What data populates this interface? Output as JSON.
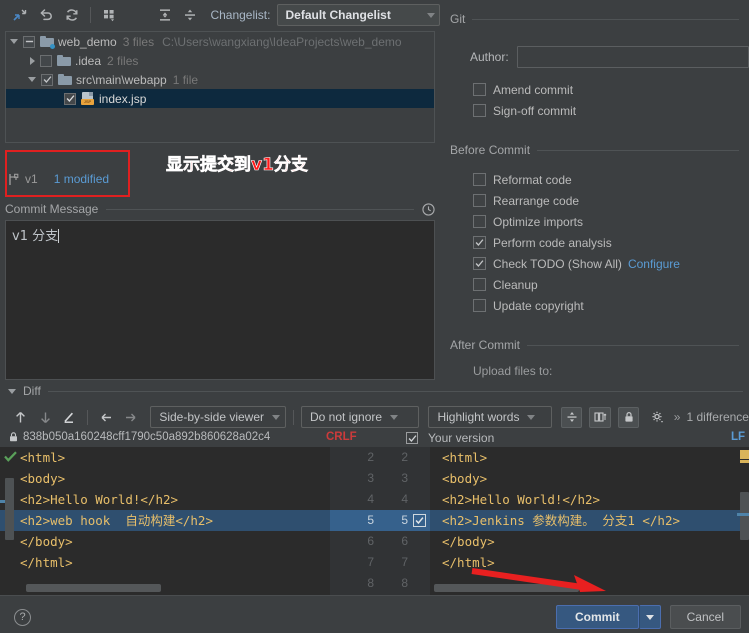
{
  "toolbar": {
    "icons": [
      "collapse-all-icon",
      "undo-icon",
      "refresh-icon",
      "group-by-icon",
      "expand-all-icon",
      "collapse-lines-icon"
    ],
    "changelist_label": "Changelist:",
    "changelist_value": "Default Changelist"
  },
  "tree": {
    "rows": [
      {
        "name": "web_demo",
        "meta": "3 files",
        "path": "C:\\Users\\wangxiang\\IdeaProjects\\web_demo",
        "indent": 0,
        "expanded": true,
        "checkstate": "partial",
        "icon": "folder-icon",
        "selected": false
      },
      {
        "name": ".idea",
        "meta": "2 files",
        "path": "",
        "indent": 1,
        "expanded": false,
        "checkstate": "off",
        "icon": "folder-icon",
        "selected": false
      },
      {
        "name": "src\\main\\webapp",
        "meta": "1 file",
        "path": "",
        "indent": 1,
        "expanded": true,
        "checkstate": "on",
        "icon": "folder-icon",
        "selected": false
      },
      {
        "name": "index.jsp",
        "meta": "",
        "path": "",
        "indent": 2,
        "expanded": null,
        "checkstate": "on",
        "icon": "jsp-file-icon",
        "selected": true
      }
    ]
  },
  "branch": {
    "icon": "git-branch-icon",
    "name": "v1",
    "modified": "1 modified",
    "annotation": "显示提交到v1分支",
    "annotation_color": "#ff1a1a",
    "highlight_color": "#e02020"
  },
  "commit_message": {
    "title": "Commit Message",
    "history_icon": "clock-icon",
    "value": "v1 分支"
  },
  "git_panel": {
    "section_git": "Git",
    "author_label": "Author:",
    "author_value": "",
    "git_checks": [
      {
        "label": "Amend commit",
        "checked": false
      },
      {
        "label": "Sign-off commit",
        "checked": false
      }
    ],
    "section_before": "Before Commit",
    "before_checks": [
      {
        "label": "Reformat code",
        "checked": false,
        "link": ""
      },
      {
        "label": "Rearrange code",
        "checked": false,
        "link": ""
      },
      {
        "label": "Optimize imports",
        "checked": false,
        "link": ""
      },
      {
        "label": "Perform code analysis",
        "checked": true,
        "link": ""
      },
      {
        "label": "Check TODO (Show All)",
        "checked": true,
        "link": "Configure"
      },
      {
        "label": "Cleanup",
        "checked": false,
        "link": ""
      },
      {
        "label": "Update copyright",
        "checked": false,
        "link": ""
      }
    ],
    "section_after": "After Commit",
    "after_label": "Upload files to:"
  },
  "diff": {
    "title": "Diff",
    "nav_icons": [
      "prev-diff-icon",
      "next-diff-icon",
      "edit-icon",
      "apply-left-icon",
      "apply-right-icon"
    ],
    "viewer_mode": "Side-by-side viewer",
    "ignore_mode": "Do not ignore",
    "highlight_mode": "Highlight words",
    "toggle_icons": [
      "collapse-unchanged-icon",
      "toggle-columns-icon",
      "lock-icon",
      "settings-icon"
    ],
    "overflow": "»",
    "difference_count": "1 difference",
    "commit_hash": "838b050a160248cff1790c50a892b860628a02c4",
    "lock_icon": "lock-icon",
    "left_line_ending": "CRLF",
    "right_line_ending": "LF",
    "right_title": "Your version",
    "right_title_checked": true,
    "line_numbers_left": [
      "2",
      "3",
      "4",
      "5",
      "6",
      "7",
      "8"
    ],
    "line_numbers_right": [
      "2",
      "3",
      "4",
      "5",
      "6",
      "7",
      "8"
    ],
    "left_lines": [
      {
        "text": "<html>",
        "highlight": false
      },
      {
        "text": "<body>",
        "highlight": false
      },
      {
        "text": "<h2>Hello World!</h2>",
        "highlight": false
      },
      {
        "text": "<h2>web hook  自动构建</h2>",
        "highlight": true
      },
      {
        "text": "</body>",
        "highlight": false
      },
      {
        "text": "</html>",
        "highlight": false
      }
    ],
    "right_lines": [
      {
        "text": "<html>",
        "highlight": false
      },
      {
        "text": "<body>",
        "highlight": false
      },
      {
        "text": "<h2>Hello World!</h2>",
        "highlight": false
      },
      {
        "text": "<h2>Jenkins 参数构建。 分支1 </h2>",
        "highlight": true
      },
      {
        "text": "</body>",
        "highlight": false
      },
      {
        "text": "</html>",
        "highlight": false
      }
    ]
  },
  "bottom": {
    "help_icon": "question-mark-icon",
    "commit_label": "Commit",
    "commit_dropdown_icon": "chevron-down-icon",
    "cancel_label": "Cancel",
    "commit_color": "#365880"
  }
}
